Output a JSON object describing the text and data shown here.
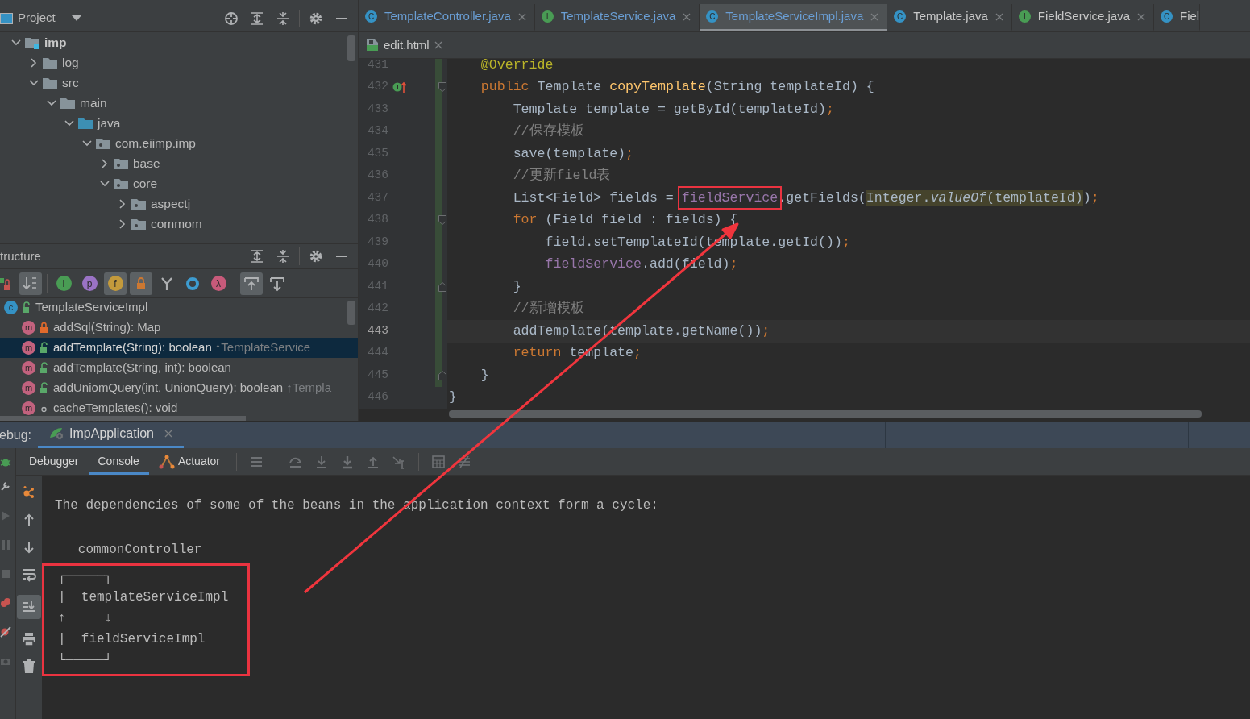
{
  "project_panel": {
    "title": "Project",
    "tree": [
      {
        "label": "imp",
        "kind": "module",
        "expanded": true,
        "children": [
          {
            "label": "log",
            "kind": "folder",
            "expanded": false
          },
          {
            "label": "src",
            "kind": "folder",
            "expanded": true,
            "children": [
              {
                "label": "main",
                "kind": "folder",
                "expanded": true,
                "children": [
                  {
                    "label": "java",
                    "kind": "source",
                    "expanded": true,
                    "children": [
                      {
                        "label": "com.eiimp.imp",
                        "kind": "package",
                        "expanded": true,
                        "children": [
                          {
                            "label": "base",
                            "kind": "package",
                            "expanded": false
                          },
                          {
                            "label": "core",
                            "kind": "package",
                            "expanded": true,
                            "children": [
                              {
                                "label": "aspectj",
                                "kind": "package",
                                "expanded": false
                              },
                              {
                                "label": "commom",
                                "kind": "package",
                                "expanded": false
                              }
                            ]
                          }
                        ]
                      }
                    ]
                  }
                ]
              }
            ]
          }
        ]
      }
    ]
  },
  "structure_panel": {
    "title": "tructure",
    "toolbar": [
      {
        "kind": "visibility",
        "on": false
      },
      {
        "kind": "sort",
        "on": true
      },
      {
        "kind": "letter",
        "icon": "I",
        "color": "#499c54",
        "on": false
      },
      {
        "kind": "letter",
        "icon": "p",
        "color": "#9a73c5",
        "on": false
      },
      {
        "kind": "letter",
        "icon": "f",
        "color": "#c39a3c",
        "on": true
      },
      {
        "kind": "lock",
        "on": true
      },
      {
        "kind": "fork",
        "on": false
      },
      {
        "kind": "ring",
        "on": false
      },
      {
        "kind": "letter",
        "icon": "λ",
        "color": "#c75a7a",
        "on": false
      },
      {
        "kind": "scroll-from",
        "on": true
      },
      {
        "kind": "scroll-to",
        "on": false
      }
    ],
    "items": [
      {
        "label": "TemplateServiceImpl",
        "kind": "public-class",
        "icon": "c",
        "selected": false,
        "children": [
          {
            "label": "addSql(String): Map",
            "kind": "private-method",
            "icon": "m",
            "selected": false
          },
          {
            "label": "addTemplate(String): boolean",
            "kind": "public-method",
            "icon": "m",
            "selected": true,
            "inherited": "↑TemplateService"
          },
          {
            "label": "addTemplate(String, int): boolean",
            "kind": "public-method",
            "icon": "m",
            "selected": false
          },
          {
            "label": "addUniomQuery(int, UnionQuery): boolean",
            "kind": "public-method",
            "icon": "m",
            "selected": false,
            "inherited": "↑Templa"
          },
          {
            "label": "cacheTemplates(): void",
            "kind": "package-method",
            "icon": "m",
            "selected": false
          }
        ]
      }
    ]
  },
  "editor": {
    "tabs": [
      {
        "label": "TemplateController.java",
        "kind": "class",
        "icon": "C",
        "modified": true,
        "selected": false
      },
      {
        "label": "TemplateService.java",
        "kind": "interface",
        "icon": "I",
        "modified": true,
        "selected": false
      },
      {
        "label": "TemplateServiceImpl.java",
        "kind": "class",
        "icon": "C",
        "modified": true,
        "selected": true
      },
      {
        "label": "Template.java",
        "kind": "class",
        "icon": "C",
        "modified": false,
        "selected": false
      },
      {
        "label": "FieldService.java",
        "kind": "interface",
        "icon": "I",
        "modified": false,
        "selected": false
      },
      {
        "label": "Fiel",
        "kind": "class",
        "icon": "C",
        "modified": false,
        "selected": false,
        "cut": true
      }
    ],
    "subtabs": [
      {
        "label": "edit.html",
        "kind": "html",
        "selected": false
      }
    ],
    "lines": [
      {
        "number": "431",
        "changed": true,
        "current": false,
        "tokens": [
          {
            "text": "    @Override",
            "kind": "annot"
          }
        ]
      },
      {
        "number": "432",
        "changed": true,
        "current": false,
        "fold_start": true,
        "implements_marker": true,
        "tokens": [
          {
            "text": "    public ",
            "kind": "kw"
          },
          {
            "text": "Template ",
            "kind": "plain"
          },
          {
            "text": "copyTemplate",
            "kind": "decl"
          },
          {
            "text": "(String templateId) {",
            "kind": "plain"
          }
        ]
      },
      {
        "number": "433",
        "changed": true,
        "current": false,
        "tokens": [
          {
            "text": "        Template template = getById(templateId)",
            "kind": "plain"
          },
          {
            "text": ";",
            "kind": "kw"
          }
        ]
      },
      {
        "number": "434",
        "changed": true,
        "current": false,
        "tokens": [
          {
            "text": "        //保存模板",
            "kind": "comment"
          }
        ]
      },
      {
        "number": "435",
        "changed": true,
        "current": false,
        "tokens": [
          {
            "text": "        save(template)",
            "kind": "plain"
          },
          {
            "text": ";",
            "kind": "kw"
          }
        ]
      },
      {
        "number": "436",
        "changed": true,
        "current": false,
        "tokens": [
          {
            "text": "        //更新field表",
            "kind": "comment"
          }
        ]
      },
      {
        "number": "437",
        "changed": true,
        "current": false,
        "tokens": [
          {
            "text": "        List<Field> fields = ",
            "kind": "plain"
          },
          {
            "text": "fieldService",
            "kind": "field",
            "boxed": true
          },
          {
            "text": ".getFields(",
            "kind": "plain"
          },
          {
            "text": "Integer.",
            "kind": "plain",
            "highlighted": true
          },
          {
            "text": "valueOf",
            "kind": "italic",
            "highlighted": true
          },
          {
            "text": "(templateId)",
            "kind": "plain",
            "highlighted": true
          },
          {
            "text": ")",
            "kind": "plain"
          },
          {
            "text": ";",
            "kind": "kw"
          }
        ]
      },
      {
        "number": "438",
        "changed": true,
        "current": false,
        "fold_start": true,
        "tokens": [
          {
            "text": "        for ",
            "kind": "kw"
          },
          {
            "text": "(Field field : fields) {",
            "kind": "plain"
          }
        ]
      },
      {
        "number": "439",
        "changed": true,
        "current": false,
        "tokens": [
          {
            "text": "            field.setTemplateId(template.getId())",
            "kind": "plain"
          },
          {
            "text": ";",
            "kind": "kw"
          }
        ]
      },
      {
        "number": "440",
        "changed": true,
        "current": false,
        "tokens": [
          {
            "text": "            fieldService",
            "kind": "field"
          },
          {
            "text": ".add(field)",
            "kind": "plain"
          },
          {
            "text": ";",
            "kind": "kw"
          }
        ]
      },
      {
        "number": "441",
        "changed": true,
        "current": false,
        "fold_end": true,
        "tokens": [
          {
            "text": "        }",
            "kind": "plain"
          }
        ]
      },
      {
        "number": "442",
        "changed": true,
        "current": false,
        "tokens": [
          {
            "text": "        //新增模板",
            "kind": "comment"
          }
        ]
      },
      {
        "number": "443",
        "changed": true,
        "current": true,
        "tokens": [
          {
            "text": "        addTemplate(template.getName())",
            "kind": "plain"
          },
          {
            "text": ";",
            "kind": "kw"
          }
        ]
      },
      {
        "number": "444",
        "changed": true,
        "current": false,
        "tokens": [
          {
            "text": "        return ",
            "kind": "kw"
          },
          {
            "text": "template",
            "kind": "plain"
          },
          {
            "text": ";",
            "kind": "kw"
          }
        ]
      },
      {
        "number": "445",
        "changed": true,
        "current": false,
        "fold_end": true,
        "tokens": [
          {
            "text": "    }",
            "kind": "plain"
          }
        ]
      },
      {
        "number": "446",
        "changed": false,
        "current": false,
        "tokens": [
          {
            "text": "}",
            "kind": "plain"
          }
        ]
      }
    ]
  },
  "debug": {
    "title": "ebug:",
    "sessions": [
      {
        "label": "ImpApplication",
        "selected": true
      }
    ],
    "tabs": [
      {
        "label": "Debugger",
        "kind": "plain",
        "selected": false
      },
      {
        "label": "Console",
        "kind": "plain",
        "selected": true
      },
      {
        "label": "Actuator",
        "kind": "actuator",
        "selected": false
      }
    ],
    "console": {
      "message": "The dependencies of some of the beans in the application context form a cycle:",
      "root": "   commonController",
      "cycle": {
        "boxed": true,
        "lines": [
          "┌─────┐",
          "|  templateServiceImpl",
          "↑     ↓",
          "|  fieldServiceImpl",
          "└─────┘"
        ]
      }
    }
  }
}
